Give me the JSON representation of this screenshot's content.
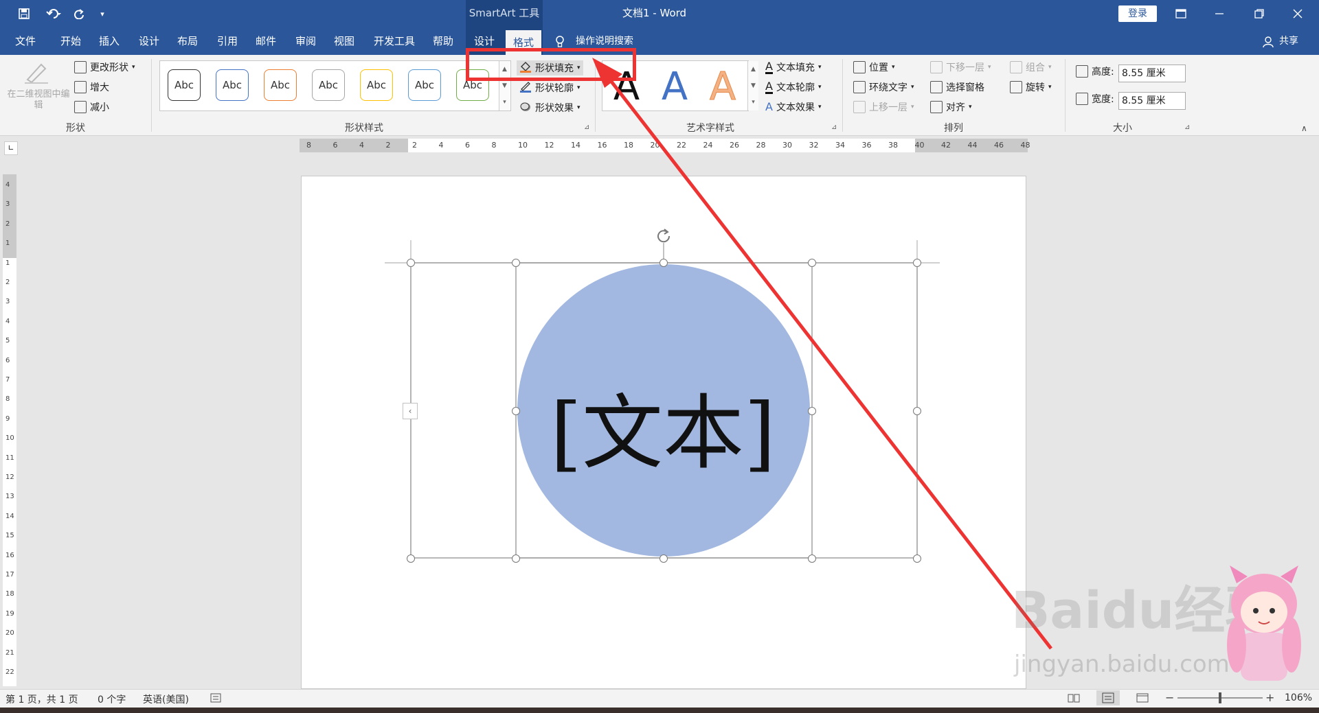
{
  "window": {
    "context_group": "SmartArt 工具",
    "doc_title": "文档1  -  Word",
    "login": "登录"
  },
  "tabs": [
    "文件",
    "开始",
    "插入",
    "设计",
    "布局",
    "引用",
    "邮件",
    "审阅",
    "视图",
    "开发工具",
    "帮助",
    "设计",
    "格式"
  ],
  "active_tab": "格式",
  "tell_me": "操作说明搜索",
  "share": "共享",
  "ribbon": {
    "shapes": {
      "edit_2d": "在二维视图中编辑",
      "change_shape": "更改形状",
      "larger": "增大",
      "smaller": "减小",
      "label": "形状"
    },
    "shape_styles": {
      "gallery": [
        "Abc",
        "Abc",
        "Abc",
        "Abc",
        "Abc",
        "Abc",
        "Abc"
      ],
      "gallery_colors": [
        "#333333",
        "#4472c4",
        "#ed7d31",
        "#a5a5a5",
        "#ffc000",
        "#5b9bd5",
        "#70ad47"
      ],
      "fill": "形状填充",
      "outline": "形状轮廓",
      "effects": "形状效果",
      "label": "形状样式"
    },
    "wordart": {
      "letters": [
        "A",
        "A",
        "A"
      ],
      "letter_colors": [
        "#111111",
        "#4472c4",
        "#f4b183"
      ],
      "text_fill": "文本填充",
      "text_outline": "文本轮廓",
      "text_effects": "文本效果",
      "label": "艺术字样式"
    },
    "arrange": {
      "position": "位置",
      "wrap_text": "环绕文字",
      "bring_forward": "上移一层",
      "send_backward": "下移一层",
      "selection_pane": "选择窗格",
      "align": "对齐",
      "group": "组合",
      "rotate": "旋转",
      "label": "排列"
    },
    "size": {
      "height_label": "高度:",
      "height_value": "8.55 厘米",
      "width_label": "宽度:",
      "width_value": "8.55 厘米",
      "label": "大小"
    }
  },
  "ruler_h": [
    "8",
    "6",
    "4",
    "2",
    "2",
    "4",
    "6",
    "8",
    "10",
    "12",
    "14",
    "16",
    "18",
    "20",
    "22",
    "24",
    "26",
    "28",
    "30",
    "32",
    "34",
    "36",
    "38",
    "40",
    "42",
    "44",
    "46",
    "48"
  ],
  "ruler_v": [
    "4",
    "3",
    "2",
    "1",
    "1",
    "2",
    "3",
    "4",
    "5",
    "6",
    "7",
    "8",
    "9",
    "10",
    "11",
    "12",
    "13",
    "14",
    "15",
    "16",
    "17",
    "18",
    "19",
    "20",
    "21",
    "22"
  ],
  "smartart": {
    "placeholder": "[文本]",
    "circle_color": "#a2b8e0"
  },
  "status": {
    "pages": "第 1 页，共 1 页",
    "words": "0 个字",
    "language": "英语(美国)",
    "zoom": "106%"
  },
  "watermark": {
    "line1": "Baidu经验",
    "line2": "jingyan.baidu.com"
  },
  "annotation_color": "#ee3333"
}
